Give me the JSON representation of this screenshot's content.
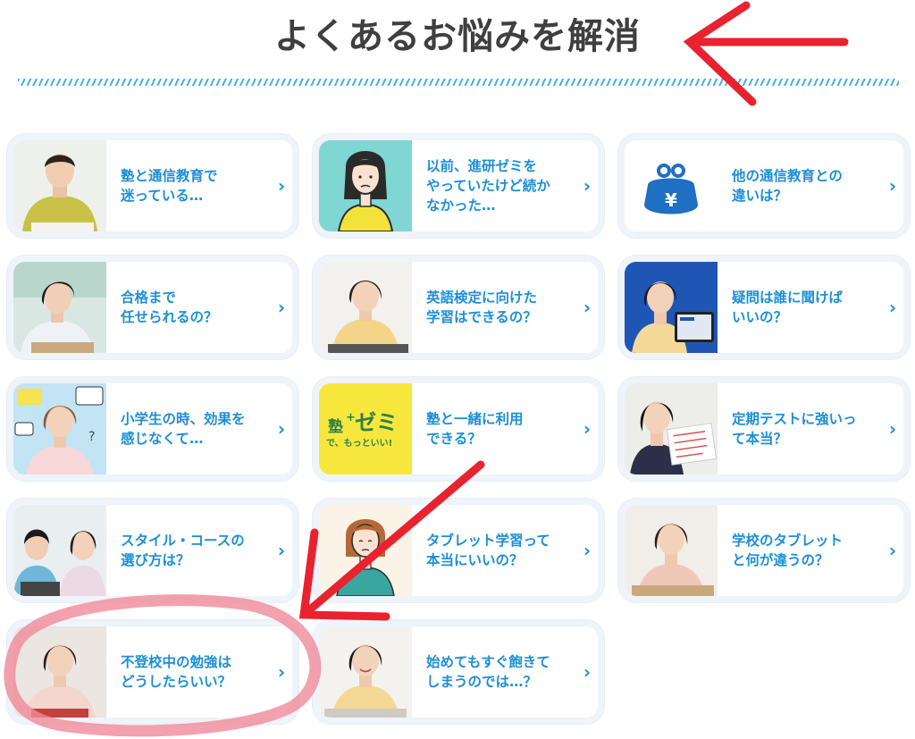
{
  "heading": "よくあるお悩みを解消",
  "chevron": "›",
  "badge_text": {
    "juku": "塾",
    "plus": "+",
    "zemi": "ゼミ",
    "sub": "で、もっといい!"
  },
  "colors": {
    "accent": "#1d8fd6",
    "heading": "#3f3f3f",
    "annotation": "#e8222e"
  },
  "cards": [
    {
      "label": "塾と通信教育で\n迷っている…",
      "icon": "student-photo"
    },
    {
      "label": "以前、進研ゼミを\nやっていたけど続か\nなかった…",
      "icon": "worried-girl-illustration"
    },
    {
      "label": "他の通信教育との\n違いは？",
      "icon": "yen-purse-icon"
    },
    {
      "label": "合格まで\n任せられるの？",
      "icon": "student-photo"
    },
    {
      "label": "英語検定に向けた\n学習はできるの？",
      "icon": "student-photo"
    },
    {
      "label": "疑問は誰に聞けば\nいいの？",
      "icon": "student-tablet-photo"
    },
    {
      "label": "小学生の時、効果を\n感じなくて…",
      "icon": "thinking-girl-photo"
    },
    {
      "label": "塾と一緒に利用\nできる？",
      "icon": "juku-plus-zemi-badge"
    },
    {
      "label": "定期テストに強いっ\nて本当？",
      "icon": "student-photo"
    },
    {
      "label": "スタイル・コースの\n選び方は？",
      "icon": "two-students-photo"
    },
    {
      "label": "タブレット学習って\n本当にいいの？",
      "icon": "worried-woman-illustration"
    },
    {
      "label": "学校のタブレット\nと何が違うの？",
      "icon": "student-photo"
    },
    {
      "label": "不登校中の勉強は\nどうしたらいい？",
      "icon": "student-photo"
    },
    {
      "label": "始めてもすぐ飽きて\nしまうのでは…？",
      "icon": "student-photo"
    }
  ]
}
